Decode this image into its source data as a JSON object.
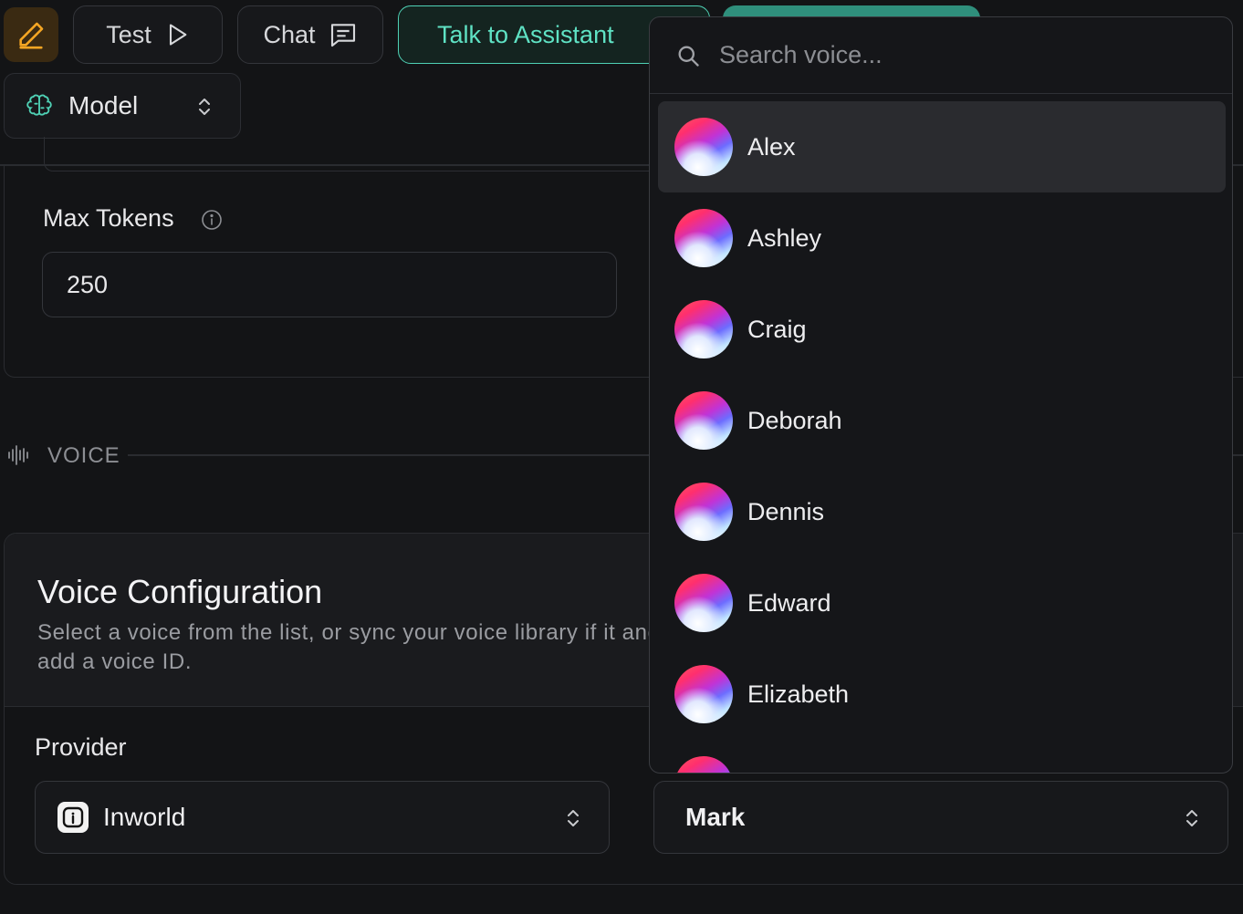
{
  "toolbar": {
    "test_label": "Test",
    "chat_label": "Chat",
    "talk_label": "Talk to Assistant",
    "model_label": "Model",
    "accent_color": "#4fd1b5"
  },
  "model_settings": {
    "max_tokens_label": "Max Tokens",
    "max_tokens_value": "250"
  },
  "voice_section": {
    "heading": "VOICE",
    "config_title": "Voice Configuration",
    "config_description": "Select a voice from the list, or sync your voice library if it and add a voice ID.",
    "provider_label": "Provider",
    "provider_value": "Inworld",
    "voice_value": "Mark"
  },
  "voice_dropdown": {
    "search_placeholder": "Search voice...",
    "items": [
      {
        "label": "Alex",
        "selected": true
      },
      {
        "label": "Ashley",
        "selected": false
      },
      {
        "label": "Craig",
        "selected": false
      },
      {
        "label": "Deborah",
        "selected": false
      },
      {
        "label": "Dennis",
        "selected": false
      },
      {
        "label": "Edward",
        "selected": false
      },
      {
        "label": "Elizabeth",
        "selected": false
      }
    ]
  },
  "icons": {
    "edit": "pencil-icon",
    "test": "play-icon",
    "chat": "message-icon",
    "model": "brain-icon",
    "info": "info-icon",
    "voice": "waveform-icon",
    "search": "search-icon",
    "select": "chevron-up-down-icon"
  }
}
